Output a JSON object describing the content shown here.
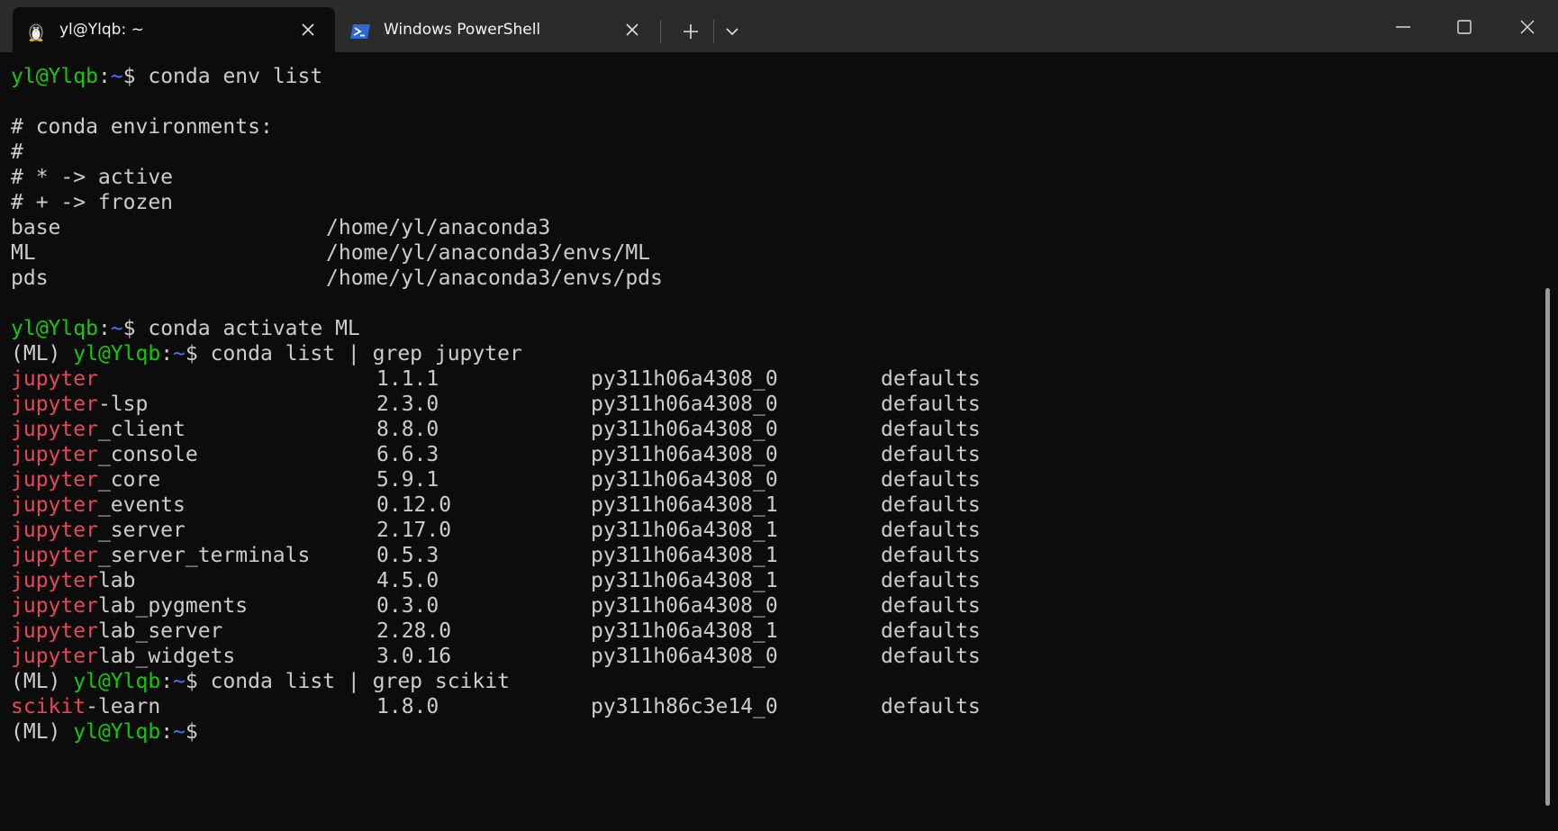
{
  "tabs": [
    {
      "title": "yl@Ylqb: ~",
      "icon": "linux-penguin-icon",
      "active": true
    },
    {
      "title": "Windows PowerShell",
      "icon": "powershell-icon",
      "active": false
    }
  ],
  "titlebar": {
    "new_tab": "+",
    "dropdown": "⌄",
    "minimize": "—",
    "maximize": "☐",
    "close": "✕"
  },
  "prompt": {
    "user_host": "yl@Ylqb",
    "colon": ":",
    "path": "~",
    "dollar": "$ ",
    "env_prefix": "(ML) "
  },
  "commands": {
    "env_list": "conda env list",
    "activate": "conda activate ML",
    "grep_jupyter": "conda list | grep jupyter",
    "grep_scikit": "conda list | grep scikit"
  },
  "env_header": [
    "# conda environments:",
    "#",
    "# * -> active",
    "# + -> frozen"
  ],
  "environments": [
    {
      "name": "base",
      "path": "/home/yl/anaconda3"
    },
    {
      "name": "ML",
      "path": "/home/yl/anaconda3/envs/ML"
    },
    {
      "name": "pds",
      "path": "/home/yl/anaconda3/envs/pds"
    }
  ],
  "jupyter_packages": [
    {
      "match": "jupyter",
      "rest": "",
      "version": "1.1.1",
      "build": "py311h06a4308_0",
      "channel": "defaults"
    },
    {
      "match": "jupyter",
      "rest": "-lsp",
      "version": "2.3.0",
      "build": "py311h06a4308_0",
      "channel": "defaults"
    },
    {
      "match": "jupyter",
      "rest": "_client",
      "version": "8.8.0",
      "build": "py311h06a4308_0",
      "channel": "defaults"
    },
    {
      "match": "jupyter",
      "rest": "_console",
      "version": "6.6.3",
      "build": "py311h06a4308_0",
      "channel": "defaults"
    },
    {
      "match": "jupyter",
      "rest": "_core",
      "version": "5.9.1",
      "build": "py311h06a4308_0",
      "channel": "defaults"
    },
    {
      "match": "jupyter",
      "rest": "_events",
      "version": "0.12.0",
      "build": "py311h06a4308_1",
      "channel": "defaults"
    },
    {
      "match": "jupyter",
      "rest": "_server",
      "version": "2.17.0",
      "build": "py311h06a4308_1",
      "channel": "defaults"
    },
    {
      "match": "jupyter",
      "rest": "_server_terminals",
      "version": "0.5.3",
      "build": "py311h06a4308_1",
      "channel": "defaults"
    },
    {
      "match": "jupyter",
      "rest": "lab",
      "version": "4.5.0",
      "build": "py311h06a4308_1",
      "channel": "defaults"
    },
    {
      "match": "jupyter",
      "rest": "lab_pygments",
      "version": "0.3.0",
      "build": "py311h06a4308_0",
      "channel": "defaults"
    },
    {
      "match": "jupyter",
      "rest": "lab_server",
      "version": "2.28.0",
      "build": "py311h06a4308_1",
      "channel": "defaults"
    },
    {
      "match": "jupyter",
      "rest": "lab_widgets",
      "version": "3.0.16",
      "build": "py311h06a4308_0",
      "channel": "defaults"
    }
  ],
  "scikit_packages": [
    {
      "match": "scikit",
      "rest": "-learn",
      "version": "1.8.0",
      "build": "py311h86c3e14_0",
      "channel": "defaults"
    }
  ],
  "colors": {
    "user_host": "#16c60c",
    "path": "#3b78ff",
    "grep_match": "#e74856",
    "text": "#cccccc",
    "background": "#0c0c0c",
    "titlebar": "#2b2b2b"
  }
}
